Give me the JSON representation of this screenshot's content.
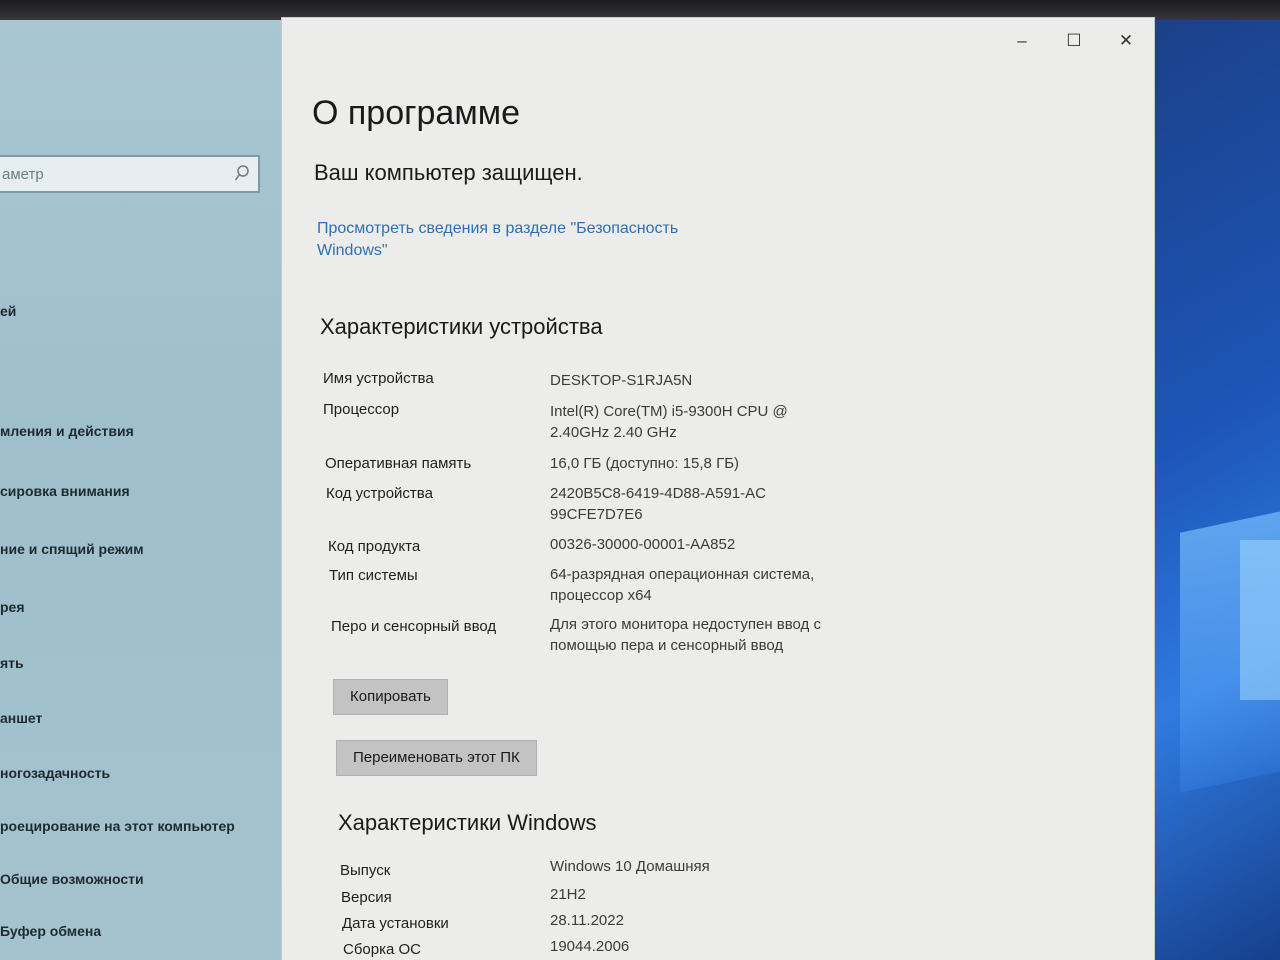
{
  "nav": {
    "search_placeholder": "аметр",
    "items": [
      "ей",
      "мления и действия",
      "сировка внимания",
      "ние и спящий режим",
      "рея",
      "ять",
      "аншет",
      "ногозадачность",
      "роецирование на этот компьютер",
      "Общие возможности",
      "Буфер обмена"
    ]
  },
  "window": {
    "title": "О программе",
    "controls": {
      "minimize": "–",
      "maximize": "☐",
      "close": "✕"
    },
    "protection_status": "Ваш компьютер защищен.",
    "security_link": "Просмотреть сведения в разделе \"Безопасность Windows\"",
    "device_section": {
      "title": "Характеристики устройства",
      "rows": [
        {
          "label": "Имя устройства",
          "value": "DESKTOP-S1RJA5N"
        },
        {
          "label": "Процессор",
          "value": "Intel(R) Core(TM) i5-9300H CPU @ 2.40GHz   2.40 GHz"
        },
        {
          "label": "Оперативная память",
          "value": "16,0 ГБ (доступно: 15,8 ГБ)"
        },
        {
          "label": "Код устройства",
          "value": "2420B5C8-6419-4D88-A591-AC99CFE7D7E6"
        },
        {
          "label": "Код продукта",
          "value": "00326-30000-00001-AA852"
        },
        {
          "label": "Тип системы",
          "value": "64-разрядная операционная система, процессор x64"
        },
        {
          "label": "Перо и сенсорный ввод",
          "value": "Для этого монитора недоступен ввод с помощью пера и сенсорный ввод"
        }
      ],
      "copy_button": "Копировать",
      "rename_button": "Переименовать этот ПК"
    },
    "windows_section": {
      "title": "Характеристики Windows",
      "rows": [
        {
          "label": "Выпуск",
          "value": "Windows 10 Домашняя"
        },
        {
          "label": "Версия",
          "value": "21H2"
        },
        {
          "label": "Дата установки",
          "value": "28.11.2022"
        },
        {
          "label": "Сборка ОС",
          "value": "19044.2006"
        }
      ]
    }
  },
  "colors": {
    "link": "#2d6fb4",
    "window_bg": "#ececea",
    "nav_bg": "#a9c6d2"
  }
}
